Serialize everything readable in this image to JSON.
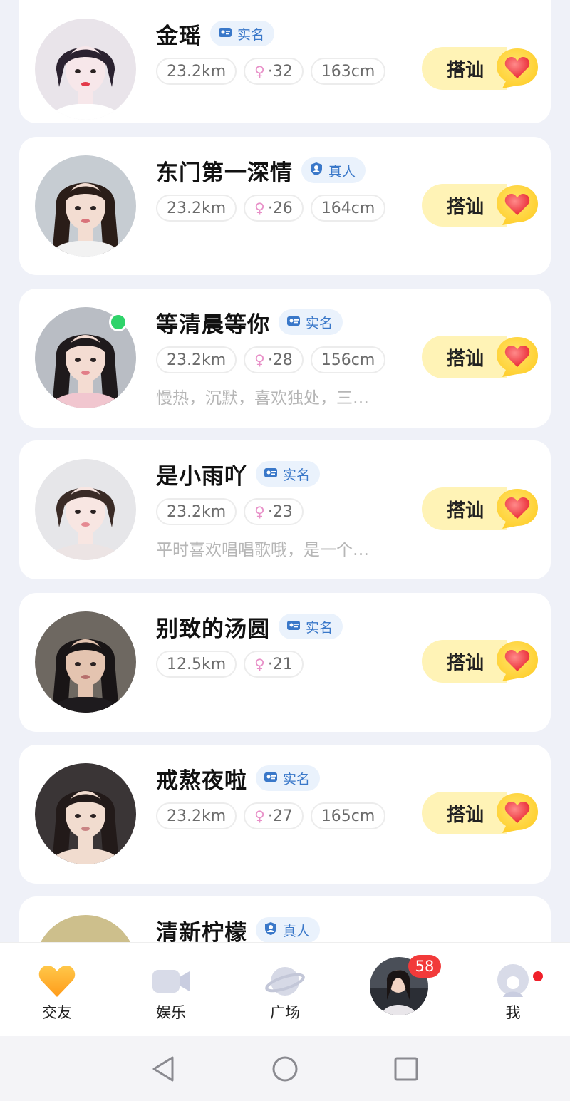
{
  "colors": {
    "page_background": "#eff1f8",
    "card_background": "#ffffff",
    "badge_text": "#3a78c9",
    "chat_button": "#fff3b6",
    "online": "#2fd36a",
    "unread_badge": "#f23a3a"
  },
  "profiles": [
    {
      "name": "金瑶",
      "badge": "实名",
      "badge_icon": "id-card-icon",
      "distance": "23.2km",
      "age": "32",
      "height": "163cm",
      "bio": "",
      "online": false,
      "cta": "搭讪"
    },
    {
      "name": "东门第一深情",
      "badge": "真人",
      "badge_icon": "person-verified-icon",
      "distance": "23.2km",
      "age": "26",
      "height": "164cm",
      "bio": "",
      "online": false,
      "cta": "搭讪"
    },
    {
      "name": "等清晨等你",
      "badge": "实名",
      "badge_icon": "id-card-icon",
      "distance": "23.2km",
      "age": "28",
      "height": "156cm",
      "bio": "慢热，沉默，喜欢独处，三…",
      "online": true,
      "cta": "搭讪"
    },
    {
      "name": "是小雨吖",
      "badge": "实名",
      "badge_icon": "id-card-icon",
      "distance": "23.2km",
      "age": "23",
      "height": "",
      "bio": "平时喜欢唱唱歌哦，是一个…",
      "online": false,
      "cta": "搭讪"
    },
    {
      "name": "别致的汤圆",
      "badge": "实名",
      "badge_icon": "id-card-icon",
      "distance": "12.5km",
      "age": "21",
      "height": "",
      "bio": "",
      "online": false,
      "cta": "搭讪"
    },
    {
      "name": "戒熬夜啦",
      "badge": "实名",
      "badge_icon": "id-card-icon",
      "distance": "23.2km",
      "age": "27",
      "height": "165cm",
      "bio": "",
      "online": false,
      "cta": "搭讪"
    },
    {
      "name": "清新柠檬",
      "badge": "真人",
      "badge_icon": "person-verified-icon",
      "distance": "",
      "age": "",
      "height": "",
      "bio": "",
      "online": false,
      "cta": ""
    }
  ],
  "tabbar": {
    "items": [
      {
        "label": "交友",
        "icon": "heart-icon",
        "active": true
      },
      {
        "label": "娱乐",
        "icon": "video-camera-icon",
        "active": false
      },
      {
        "label": "广场",
        "icon": "planet-icon",
        "active": false
      },
      {
        "label": "",
        "icon": "messages-avatar",
        "active": false
      },
      {
        "label": "我",
        "icon": "profile-icon",
        "active": false
      }
    ],
    "unread_count": "58"
  },
  "system_nav": {
    "back": "back-triangle-icon",
    "home": "home-circle-icon",
    "recents": "recents-square-icon"
  }
}
